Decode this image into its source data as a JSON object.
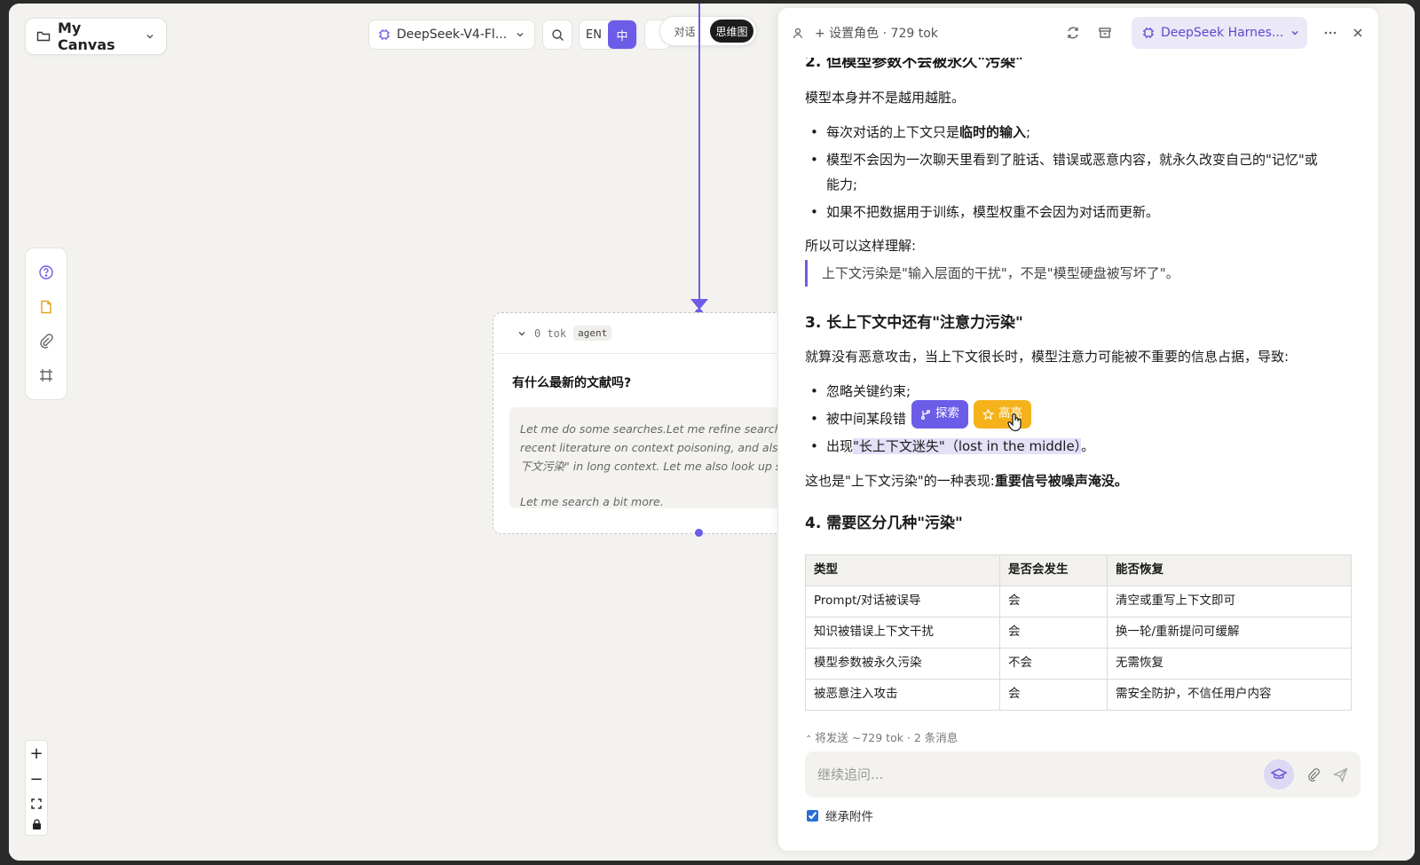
{
  "canvas": {
    "title": "My Canvas"
  },
  "toolbar": {
    "model": "DeepSeek-V4-Fl...",
    "lang_en": "EN",
    "lang_zh": "中",
    "mode_chat": "对话",
    "mode_mindmap": "思维图"
  },
  "node": {
    "tok": "0 tok",
    "badge": "agent",
    "question": "有什么最新的文献吗?",
    "thinking": [
      "Let me do some searches.Let me refine searches",
      "recent literature on context poisoning, and also t",
      "下文污染\" in long context. Let me also look up so",
      "Let me search a bit more."
    ]
  },
  "panel": {
    "role": "+ 设置角色 · 729 tok",
    "harness": "DeepSeek Harnes...",
    "content": {
      "h2_partial": "2. 但模型参数不会被永久\"污染\"",
      "p1": "模型本身并不是越用越脏。",
      "bullets1": [
        {
          "pre": "每次对话的上下文只是",
          "bold": "临时的输入",
          "post": ";"
        },
        {
          "pre": "模型不会因为一次聊天里看到了脏话、错误或恶意内容，就永久改变自己的\"记忆\"或",
          "bold": "",
          "post": ""
        },
        {
          "pre": "能力;",
          "bold": "",
          "post": ""
        },
        {
          "pre": "如果不把数据用于训练，模型权重不会因为对话而更新。",
          "bold": "",
          "post": ""
        }
      ],
      "p2": "所以可以这样理解:",
      "quote": "上下文污染是\"输入层面的干扰\"，不是\"模型硬盘被写坏了\"。",
      "h3": "3. 长上下文中还有\"注意力污染\"",
      "p3": "就算没有恶意攻击，当上下文很长时，模型注意力可能被不重要的信息占据，导致:",
      "bullets2": [
        "忽略关键约束;",
        "被中间某段错",
        "出现"
      ],
      "bullet3_hl": "\"长上下文迷失\"（lost in the middle）",
      "bullet3_end": "。",
      "p4_pre": "这也是\"上下文污染\"的一种表现:",
      "p4_bold": "重要信号被噪声淹没。",
      "h4": "4. 需要区分几种\"污染\"",
      "table": {
        "headers": [
          "类型",
          "是否会发生",
          "能否恢复"
        ],
        "rows": [
          [
            "Prompt/对话被误导",
            "会",
            "清空或重写上下文即可"
          ],
          [
            "知识被错误上下文干扰",
            "会",
            "换一轮/重新提问可缓解"
          ],
          [
            "模型参数被永久污染",
            "不会",
            "无需恢复"
          ],
          [
            "被恶意注入攻击",
            "会",
            "需安全防护，不信任用户内容"
          ]
        ]
      }
    },
    "selection_popup": {
      "explore": "探索",
      "highlight": "高亮"
    },
    "footer": {
      "send_info": "将发送 ~729 tok · 2 条消息",
      "placeholder": "继续追问...",
      "inherit_label": "继承附件",
      "inherit_checked": true
    }
  },
  "colors": {
    "accent": "#6c5ce7",
    "highlight_btn": "#f5b21b"
  }
}
